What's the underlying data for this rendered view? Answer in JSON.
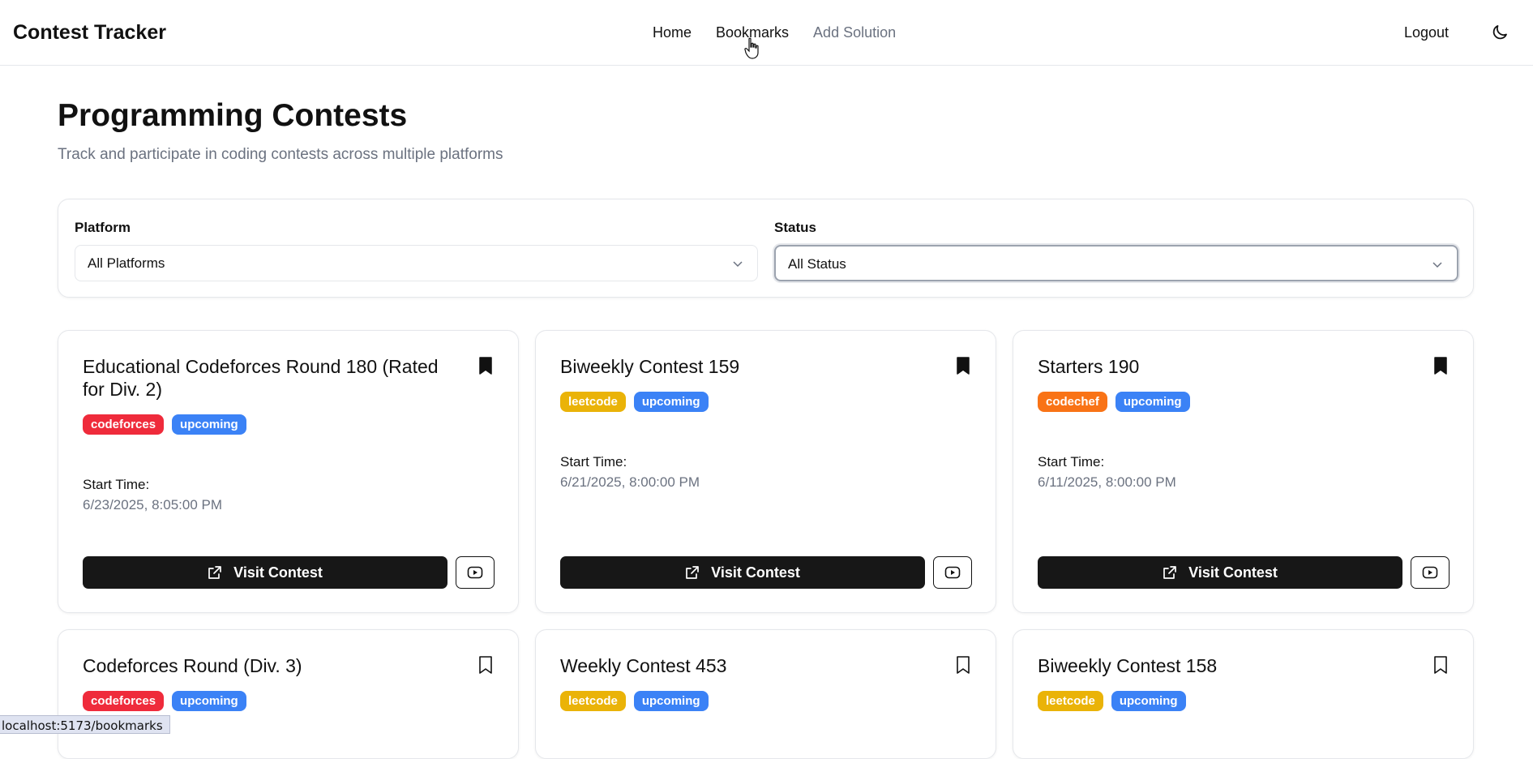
{
  "app": {
    "brand": "Contest Tracker",
    "nav": [
      "Home",
      "Bookmarks",
      "Add Solution"
    ],
    "logout_label": "Logout",
    "theme_icon": "moon-icon"
  },
  "page": {
    "title": "Programming Contests",
    "subtitle": "Track and participate in coding contests across multiple platforms"
  },
  "filters": {
    "platform_label": "Platform",
    "platform_value": "All Platforms",
    "status_label": "Status",
    "status_value": "All Status"
  },
  "colors": {
    "codeforces": "#ef2b3b",
    "leetcode": "#eab308",
    "codechef": "#f97316",
    "upcoming": "#3b82f6"
  },
  "contest_card": {
    "start_label": "Start Time:",
    "visit_label": "Visit Contest"
  },
  "contests": [
    {
      "title": "Educational Codeforces Round 180 (Rated for Div. 2)",
      "platform": "codeforces",
      "status": "upcoming",
      "start_time": "6/23/2025, 8:05:00 PM",
      "bookmarked": true
    },
    {
      "title": "Biweekly Contest 159",
      "platform": "leetcode",
      "status": "upcoming",
      "start_time": "6/21/2025, 8:00:00 PM",
      "bookmarked": true
    },
    {
      "title": "Starters 190",
      "platform": "codechef",
      "status": "upcoming",
      "start_time": "6/11/2025, 8:00:00 PM",
      "bookmarked": true
    },
    {
      "title": "Codeforces Round (Div. 3)",
      "platform": "codeforces",
      "status": "upcoming",
      "bookmarked": false
    },
    {
      "title": "Weekly Contest 453",
      "platform": "leetcode",
      "status": "upcoming",
      "bookmarked": false
    },
    {
      "title": "Biweekly Contest 158",
      "platform": "leetcode",
      "status": "upcoming",
      "bookmarked": false
    }
  ],
  "status_bar": {
    "url": "localhost:5173/bookmarks"
  }
}
